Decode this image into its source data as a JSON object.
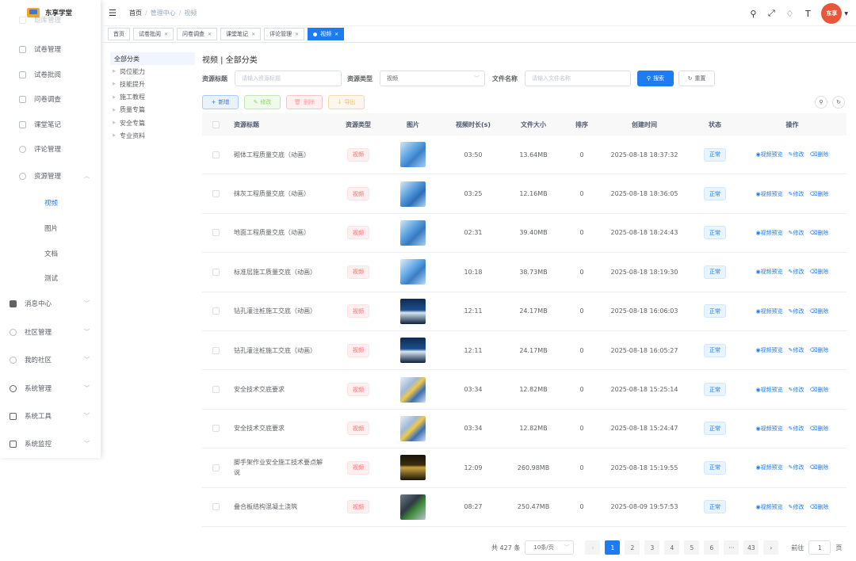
{
  "app": {
    "name": "东享学堂"
  },
  "sidebar": {
    "partial_top": "题库管理",
    "items": [
      {
        "label": "试卷管理"
      },
      {
        "label": "试卷批阅"
      },
      {
        "label": "问卷调查"
      },
      {
        "label": "课堂笔记"
      },
      {
        "label": "评论管理"
      },
      {
        "label": "资源管理"
      },
      {
        "label": "消息中心"
      },
      {
        "label": "社区管理"
      },
      {
        "label": "我的社区"
      },
      {
        "label": "系统管理"
      },
      {
        "label": "系统工具"
      },
      {
        "label": "系统监控"
      }
    ],
    "sub_items": [
      {
        "label": "视频"
      },
      {
        "label": "图片"
      },
      {
        "label": "文档"
      },
      {
        "label": "测试"
      }
    ]
  },
  "breadcrumb": {
    "home": "首页",
    "mid": "管理中心",
    "current": "视频"
  },
  "tags": [
    {
      "label": "首页"
    },
    {
      "label": "试卷批阅"
    },
    {
      "label": "问卷调查"
    },
    {
      "label": "课堂笔记"
    },
    {
      "label": "评论管理"
    },
    {
      "label": "视频"
    }
  ],
  "avatar": {
    "text": "东享"
  },
  "tree": [
    {
      "label": "全部分类"
    },
    {
      "label": "岗位能力"
    },
    {
      "label": "技能提升"
    },
    {
      "label": "施工教程"
    },
    {
      "label": "质量专篇"
    },
    {
      "label": "安全专篇"
    },
    {
      "label": "专业资料"
    }
  ],
  "page": {
    "title": "视频 | 全部分类"
  },
  "search": {
    "title_label": "资源标题",
    "title_placeholder": "请输入资源标题",
    "type_label": "资源类型",
    "type_value": "视频",
    "file_label": "文件名称",
    "file_placeholder": "请输入文件名称",
    "search_btn": "搜索",
    "reset_btn": "重置"
  },
  "actions": {
    "add": "新增",
    "edit": "修改",
    "delete": "删除",
    "export": "导出"
  },
  "table": {
    "headers": {
      "title": "资源标题",
      "type": "资源类型",
      "img": "图片",
      "duration": "视频时长(s)",
      "size": "文件大小",
      "sort": "排序",
      "time": "创建时间",
      "status": "状态",
      "ops": "操作"
    },
    "rows": [
      {
        "title": "砌体工程质量交底（动画）",
        "type": "视频",
        "duration": "03:50",
        "size": "13.64MB",
        "sort": "0",
        "time": "2025-08-18 18:37:32",
        "status": "正常"
      },
      {
        "title": "抹灰工程质量交底（动画）",
        "type": "视频",
        "duration": "03:25",
        "size": "12.16MB",
        "sort": "0",
        "time": "2025-08-18 18:36:05",
        "status": "正常"
      },
      {
        "title": "地面工程质量交底（动画）",
        "type": "视频",
        "duration": "02:31",
        "size": "39.40MB",
        "sort": "0",
        "time": "2025-08-18 18:24:43",
        "status": "正常"
      },
      {
        "title": "标准层施工质量交底（动画）",
        "type": "视频",
        "duration": "10:18",
        "size": "38.73MB",
        "sort": "0",
        "time": "2025-08-18 18:19:30",
        "status": "正常"
      },
      {
        "title": "钻孔灌注桩施工交底（动画）",
        "type": "视频",
        "duration": "12:11",
        "size": "24.17MB",
        "sort": "0",
        "time": "2025-08-18 16:06:03",
        "status": "正常"
      },
      {
        "title": "钻孔灌注桩施工交底（动画）",
        "type": "视频",
        "duration": "12:11",
        "size": "24.17MB",
        "sort": "0",
        "time": "2025-08-18 16:05:27",
        "status": "正常"
      },
      {
        "title": "安全技术交底要求",
        "type": "视频",
        "duration": "03:34",
        "size": "12.82MB",
        "sort": "0",
        "time": "2025-08-18 15:25:14",
        "status": "正常"
      },
      {
        "title": "安全技术交底要求",
        "type": "视频",
        "duration": "03:34",
        "size": "12.82MB",
        "sort": "0",
        "time": "2025-08-18 15:24:47",
        "status": "正常"
      },
      {
        "title": "脚手架作业安全施工技术要点解说",
        "type": "视频",
        "duration": "12:09",
        "size": "260.98MB",
        "sort": "0",
        "time": "2025-08-18 15:19:55",
        "status": "正常"
      },
      {
        "title": "叠合板结构混凝土浇筑",
        "type": "视频",
        "duration": "08:27",
        "size": "250.47MB",
        "sort": "0",
        "time": "2025-08-09 19:57:53",
        "status": "正常"
      }
    ],
    "op_preview": "视频预览",
    "op_edit": "修改",
    "op_delete": "删除"
  },
  "pagination": {
    "total": "共 427 条",
    "page_size": "10条/页",
    "pages": [
      "1",
      "2",
      "3",
      "4",
      "5",
      "6",
      "···",
      "43"
    ],
    "goto_label": "前往",
    "goto_value": "1",
    "page_unit": "页"
  },
  "colors": {
    "primary": "#1e7bf0",
    "danger": "#f56c6c"
  }
}
